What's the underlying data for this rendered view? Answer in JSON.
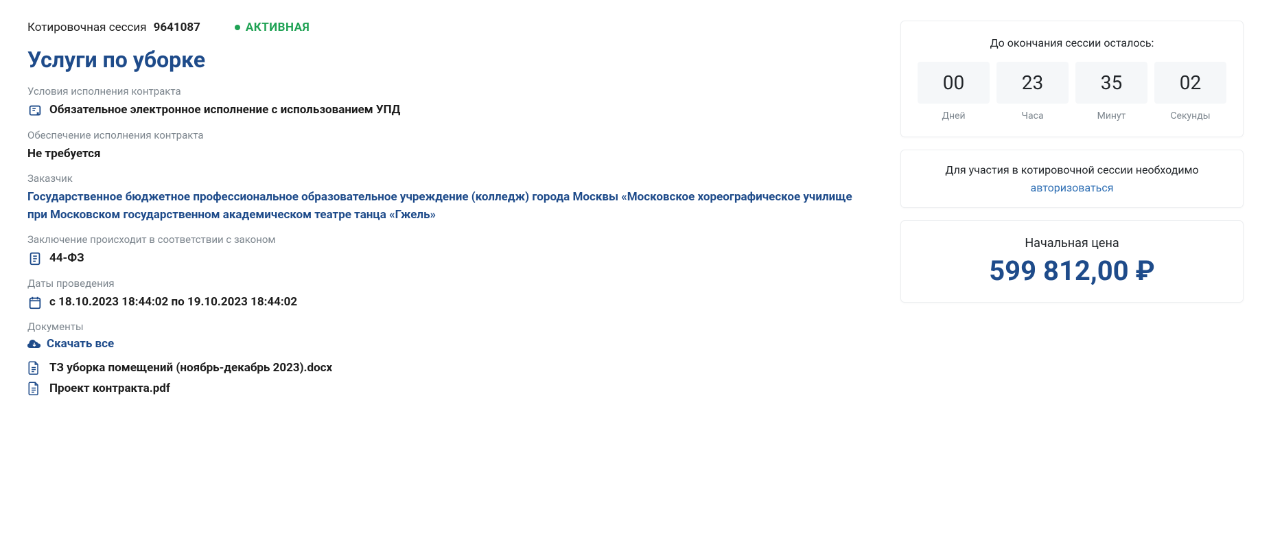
{
  "session": {
    "label": "Котировочная сессия",
    "id": "9641087",
    "status": "АКТИВНАЯ"
  },
  "title": "Услуги по уборке",
  "conditions": {
    "label": "Условия исполнения контракта",
    "value": "Обязательное электронное исполнение с использованием УПД"
  },
  "security": {
    "label": "Обеспечение исполнения контракта",
    "value": "Не требуется"
  },
  "customer": {
    "label": "Заказчик",
    "value": "Государственное бюджетное профессиональное образовательное учреждение (колледж) города Москвы «Московское хореографическое училище при Московском государственном академическом театре танца «Гжель»"
  },
  "law": {
    "label": "Заключение происходит в соответствии с законом",
    "value": "44-ФЗ"
  },
  "dates": {
    "label": "Даты проведения",
    "value": "с 18.10.2023 18:44:02 по 19.10.2023 18:44:02"
  },
  "docs": {
    "label": "Документы",
    "download_all": "Скачать все",
    "items": [
      "ТЗ уборка помещений (ноябрь-декабрь 2023).docx",
      "Проект контракта.pdf"
    ]
  },
  "countdown": {
    "title": "До окончания сессии осталось:",
    "days": "00",
    "hours": "23",
    "minutes": "35",
    "seconds": "02",
    "lab_days": "Дней",
    "lab_hours": "Часа",
    "lab_minutes": "Минут",
    "lab_seconds": "Секунды"
  },
  "participate": {
    "prefix": "Для участия в котировочной сессии необходимо ",
    "link": "авторизоваться"
  },
  "price": {
    "label": "Начальная цена",
    "value": "599 812,00 ₽"
  }
}
